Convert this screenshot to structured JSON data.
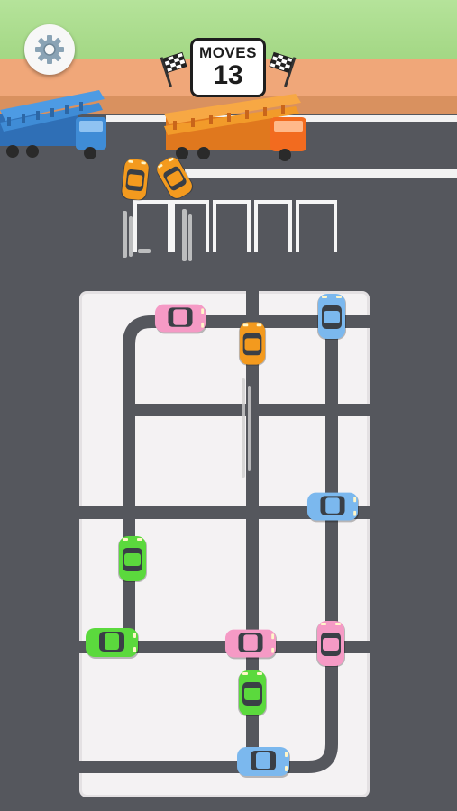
{
  "hud": {
    "moves_label": "MOVES",
    "moves_count": "13",
    "settings_icon": "gear-icon",
    "flag_icon": "checkered-flag-icon"
  },
  "colors": {
    "road": "#55575d",
    "board": "#f4f2f3",
    "grass": "#b5e39a",
    "dirt": "#f0a779",
    "car_orange": "#f39a1e",
    "car_pink": "#f59ac5",
    "car_blue": "#7bb8ee",
    "car_green": "#5bd93d",
    "truck_blue": "#3f8cd6",
    "truck_orange": "#f29b2a"
  },
  "trucks": [
    {
      "name": "blue-car-carrier",
      "color": "blue"
    },
    {
      "name": "orange-car-carrier",
      "color": "orange"
    }
  ],
  "cars": [
    {
      "id": "orange-car-exit-1",
      "color": "orange"
    },
    {
      "id": "orange-car-exit-2",
      "color": "orange"
    },
    {
      "id": "pink-car-top",
      "color": "pink"
    },
    {
      "id": "orange-car-moving",
      "color": "orange"
    },
    {
      "id": "blue-car-top-right",
      "color": "blue"
    },
    {
      "id": "blue-car-middle-right",
      "color": "blue"
    },
    {
      "id": "green-car-left-vertical",
      "color": "green"
    },
    {
      "id": "green-car-left-horizontal",
      "color": "green"
    },
    {
      "id": "pink-car-bottom-middle",
      "color": "pink"
    },
    {
      "id": "pink-car-bottom-right",
      "color": "pink"
    },
    {
      "id": "green-car-bottom-middle",
      "color": "green"
    },
    {
      "id": "blue-car-bottom",
      "color": "blue"
    }
  ],
  "parking_slots": 5
}
